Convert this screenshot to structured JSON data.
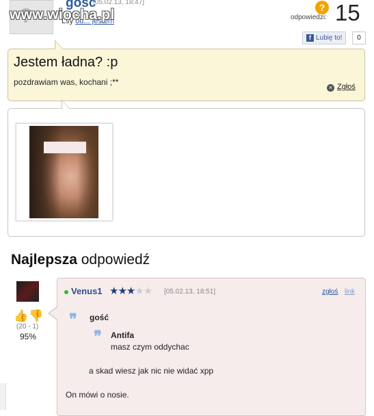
{
  "question": {
    "username": "gosc",
    "date": "[05.02.13, 18:47]",
    "subline_text": "Lsy",
    "subline_link": "ou... jestem",
    "answers_label": "odpowiedzi:",
    "answers_count": "15",
    "fb_like_label": "Lubię to!",
    "fb_like_count": "0",
    "title": "Jestem ładna? :p",
    "body": "pozdrawiam was, kochani ;**",
    "report_label": "Zgłoś"
  },
  "watermark": "www.wiocha.pl",
  "best_answer": {
    "heading_bold": "Najlepsza",
    "heading_rest": " odpowiedź",
    "votes": "(20 - 1)",
    "percent": "95%",
    "user": "Venus1",
    "rating_stars": 2.5,
    "date": "[05.02.13, 18:51]",
    "report_label": "zgłoś",
    "link_label": "link",
    "quote_outer_user": "gość",
    "quote_inner_user": "Antifa",
    "quote_inner_text": "masz czym oddychac",
    "quote_outer_text": "a skad wiesz jak nic nie widać xpp",
    "answer_text": "On mówi o nosie."
  },
  "colors": {
    "question_bg": "#fbf6d8",
    "answer_bg": "#f7ecec",
    "username_blue": "#2d5b9a",
    "badge_orange": "#f2a400",
    "star_blue": "#1e3f80"
  }
}
